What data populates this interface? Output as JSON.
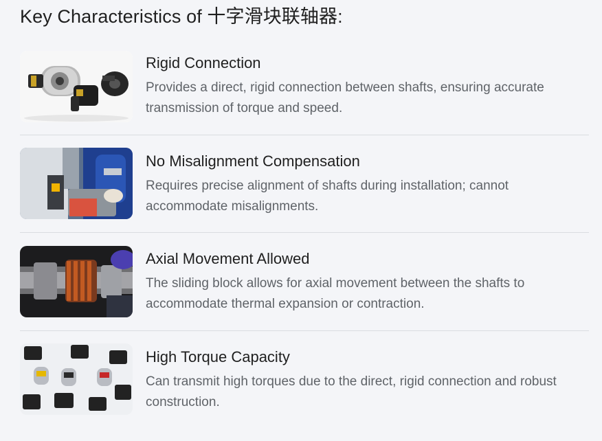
{
  "heading": "Key Characteristics of 十字滑块联轴器:",
  "items": [
    {
      "title": "Rigid Connection",
      "description": "Provides a direct, rigid connection between shafts, ensuring accurate transmission of torque and speed.",
      "image_icon": "coupling-parts-photo"
    },
    {
      "title": "No Misalignment Compensation",
      "description": "Requires precise alignment of shafts during installation; cannot accommodate misalignments.",
      "image_icon": "technician-alignment-photo"
    },
    {
      "title": "Axial Movement Allowed",
      "description": "The sliding block allows for axial movement between the shafts to accommodate thermal expansion or contraction.",
      "image_icon": "shaft-coupling-assembly-photo"
    },
    {
      "title": "High Torque Capacity",
      "description": "Can transmit high torques due to the direct, rigid connection and robust construction.",
      "image_icon": "coupling-collection-photo"
    }
  ],
  "colors": {
    "background": "#f4f5f8",
    "title_text": "#1f1f1f",
    "description_text": "#5f6368",
    "divider": "#dadce0"
  }
}
